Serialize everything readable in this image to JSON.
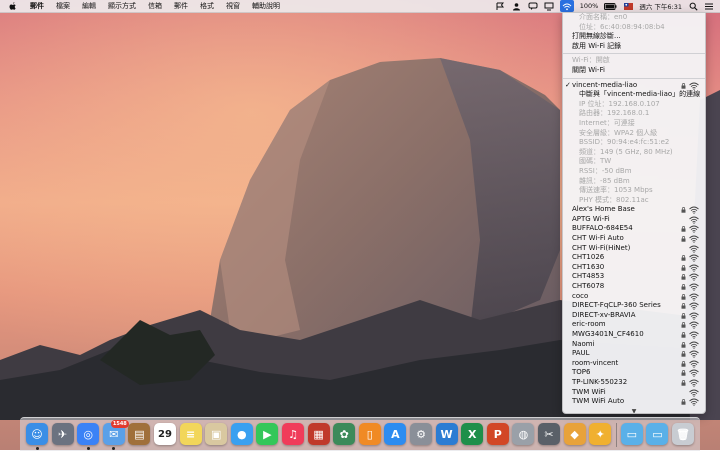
{
  "menubar": {
    "items": [
      "郵件",
      "檔案",
      "編輯",
      "顯示方式",
      "信箱",
      "郵件",
      "格式",
      "視窗",
      "輔助說明"
    ],
    "battery": "100%",
    "datetime": "週六 下午6:31"
  },
  "wifi_menu": {
    "interface_name": "介面名稱：en0",
    "address": "位址：6c:40:08:94:08:b4",
    "open_diagnostics": "打開無線診斷...",
    "enable_logging": "啟用 Wi-Fi 記錄",
    "wifi_status": "Wi-Fi：開啟",
    "turn_off": "關閉 Wi-Fi",
    "connected_network": "vincent-media-liao",
    "disconnect": "中斷與「vincent-media-liao」的連線",
    "details": [
      "IP 位址：192.168.0.107",
      "路由器：192.168.0.1",
      "Internet：可連接",
      "安全層級：WPA2 個人級",
      "BSSID：90:94:e4:fc:51:e2",
      "頻道：149 (5 GHz, 80 MHz)",
      "國碼：TW",
      "RSSI：-50 dBm",
      "雜訊：-85 dBm",
      "傳送速率：1053 Mbps",
      "PHY 模式：802.11ac"
    ],
    "networks": [
      {
        "name": "Alex's Home Base",
        "locked": true
      },
      {
        "name": "APTG Wi-Fi",
        "locked": false
      },
      {
        "name": "BUFFALO-684E54",
        "locked": true
      },
      {
        "name": "CHT Wi-Fi Auto",
        "locked": true
      },
      {
        "name": "CHT Wi-Fi(HiNet)",
        "locked": false
      },
      {
        "name": "CHT1026",
        "locked": true
      },
      {
        "name": "CHT1630",
        "locked": true
      },
      {
        "name": "CHT4853",
        "locked": true
      },
      {
        "name": "CHT6078",
        "locked": true
      },
      {
        "name": "coco",
        "locked": true
      },
      {
        "name": "DIRECT-FqCLP-360 Series",
        "locked": true
      },
      {
        "name": "DIRECT-xv-BRAVIA",
        "locked": true
      },
      {
        "name": "eric-room",
        "locked": true
      },
      {
        "name": "MWG3401N_CF4610",
        "locked": true
      },
      {
        "name": "Naomi",
        "locked": true
      },
      {
        "name": "PAUL",
        "locked": true
      },
      {
        "name": "room-vincent",
        "locked": true
      },
      {
        "name": "TOP6",
        "locked": true
      },
      {
        "name": "TP-LINK-550232",
        "locked": true
      },
      {
        "name": "TWM WiFi",
        "locked": false
      },
      {
        "name": "TWM WiFi Auto",
        "locked": true
      }
    ],
    "scroll_arrow": "▼"
  },
  "dock": {
    "mail_badge": "1548",
    "calendar_day": "29",
    "items": [
      {
        "name": "finder-icon",
        "color": "#3a8ee6",
        "glyph": "☺",
        "running": true
      },
      {
        "name": "launchpad-icon",
        "color": "#6b7280",
        "glyph": "✈",
        "running": false
      },
      {
        "name": "safari-icon",
        "color": "#3b82f6",
        "glyph": "◎",
        "running": true
      },
      {
        "name": "mail-icon",
        "color": "#5aa0e8",
        "glyph": "✉",
        "running": true
      },
      {
        "name": "notes-brown-icon",
        "color": "#a0703a",
        "glyph": "▤",
        "running": false
      },
      {
        "name": "calendar-icon",
        "color": "#ffffff",
        "glyph": "",
        "running": false
      },
      {
        "name": "notes-icon",
        "color": "#f2d65a",
        "glyph": "≡",
        "running": false
      },
      {
        "name": "preview-icon",
        "color": "#d9c8a0",
        "glyph": "▣",
        "running": false
      },
      {
        "name": "messages-icon",
        "color": "#3aa0f0",
        "glyph": "●",
        "running": false
      },
      {
        "name": "facetime-icon",
        "color": "#34c759",
        "glyph": "▶",
        "running": false
      },
      {
        "name": "music-icon",
        "color": "#f03c5a",
        "glyph": "♫",
        "running": false
      },
      {
        "name": "photo-booth-icon",
        "color": "#c0392b",
        "glyph": "▦",
        "running": false
      },
      {
        "name": "photos-icon",
        "color": "#3c8a5a",
        "glyph": "✿",
        "running": false
      },
      {
        "name": "ibooks-icon",
        "color": "#f08a24",
        "glyph": "▯",
        "running": false
      },
      {
        "name": "app-store-icon",
        "color": "#2d8cf0",
        "glyph": "A",
        "running": false
      },
      {
        "name": "system-preferences-icon",
        "color": "#8a8f98",
        "glyph": "⚙",
        "running": false
      },
      {
        "name": "word-icon",
        "color": "#2b7cd3",
        "glyph": "W",
        "running": false
      },
      {
        "name": "excel-icon",
        "color": "#1e8f4a",
        "glyph": "X",
        "running": false
      },
      {
        "name": "powerpoint-icon",
        "color": "#d24726",
        "glyph": "P",
        "running": false
      },
      {
        "name": "network-utility-icon",
        "color": "#9aa0a8",
        "glyph": "◍",
        "running": false
      },
      {
        "name": "terminal-tools-icon",
        "color": "#5a6068",
        "glyph": "✂",
        "running": false
      },
      {
        "name": "sketch-icon",
        "color": "#e8a23a",
        "glyph": "◆",
        "running": false
      },
      {
        "name": "xcode-icon",
        "color": "#f0b030",
        "glyph": "✦",
        "running": false
      },
      {
        "name": "applications-folder-icon",
        "color": "#5ab0e8",
        "glyph": "▭",
        "running": false
      },
      {
        "name": "documents-folder-icon",
        "color": "#5ab0e8",
        "glyph": "▭",
        "running": false
      },
      {
        "name": "trash-icon",
        "color": "#c8ccd2",
        "glyph": "🗑",
        "running": false
      }
    ]
  }
}
